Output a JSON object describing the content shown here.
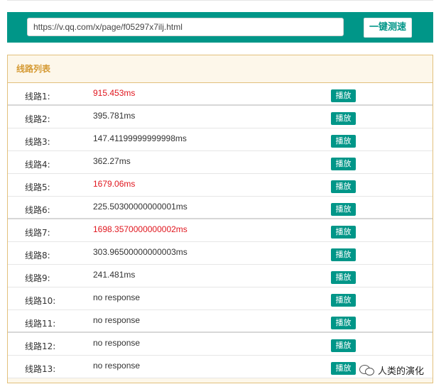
{
  "toolbar": {
    "url_value": "https://v.qq.com/x/page/f05297x7ilj.html",
    "speed_test_label": "一键测速"
  },
  "panel": {
    "title": "线路列表",
    "rows": [
      {
        "name": "线路1:",
        "latency": "915.453ms",
        "slow": true,
        "action": "播放"
      },
      {
        "name": "线路2:",
        "latency": "395.781ms",
        "slow": false,
        "action": "播放"
      },
      {
        "name": "线路3:",
        "latency": "147.41199999999998ms",
        "slow": false,
        "action": "播放"
      },
      {
        "name": "线路4:",
        "latency": "362.27ms",
        "slow": false,
        "action": "播放"
      },
      {
        "name": "线路5:",
        "latency": "1679.06ms",
        "slow": true,
        "action": "播放"
      },
      {
        "name": "线路6:",
        "latency": "225.50300000000001ms",
        "slow": false,
        "action": "播放"
      },
      {
        "name": "线路7:",
        "latency": "1698.3570000000002ms",
        "slow": true,
        "action": "播放"
      },
      {
        "name": "线路8:",
        "latency": "303.96500000000003ms",
        "slow": false,
        "action": "播放"
      },
      {
        "name": "线路9:",
        "latency": "241.481ms",
        "slow": false,
        "action": "播放"
      },
      {
        "name": "线路10:",
        "latency": "no response",
        "slow": false,
        "action": "播放"
      },
      {
        "name": "线路11:",
        "latency": "no response",
        "slow": false,
        "action": "播放"
      },
      {
        "name": "线路12:",
        "latency": "no response",
        "slow": false,
        "action": "播放"
      },
      {
        "name": "线路13:",
        "latency": "no response",
        "slow": false,
        "action": "播放"
      }
    ]
  },
  "colors": {
    "accent": "#009688",
    "slow_latency": "#e0161e",
    "panel_header_text": "#d59a33"
  },
  "watermark": {
    "icon": "wechat-icon",
    "text": "人类的演化"
  }
}
